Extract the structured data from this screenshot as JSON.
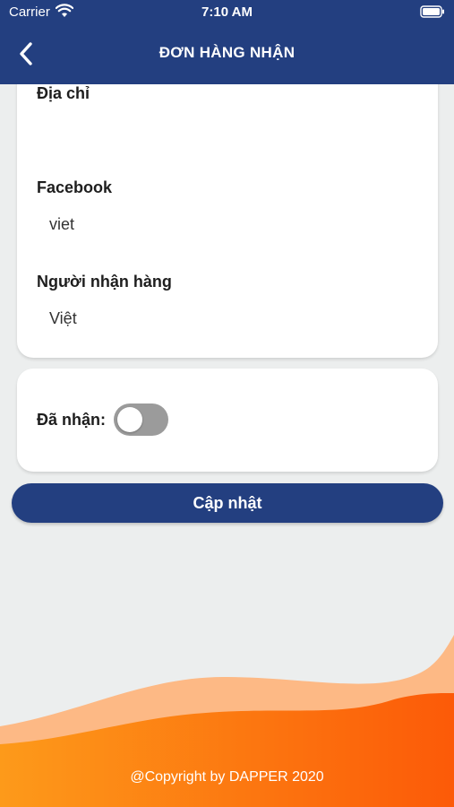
{
  "status_bar": {
    "carrier": "Carrier",
    "time": "7:10 AM"
  },
  "header": {
    "title": "ĐƠN HÀNG NHẬN"
  },
  "info_card": {
    "address_label": "Địa chỉ",
    "address_value": "",
    "facebook_label": "Facebook",
    "facebook_value": "viet",
    "receiver_label": "Người nhận hàng",
    "receiver_value": "Việt"
  },
  "status_card": {
    "received_label": "Đã nhận:",
    "received_on": false
  },
  "update_button": {
    "label": "Cập nhật"
  },
  "footer": {
    "copyright": "@Copyright by DAPPER 2020"
  },
  "colors": {
    "header": "#233f80",
    "background": "#eceeee",
    "wave_light": "#fdb985",
    "wave_orange_start": "#fd9a1a",
    "wave_orange_end": "#fc5a08",
    "toggle_off": "#9b9b9b"
  }
}
